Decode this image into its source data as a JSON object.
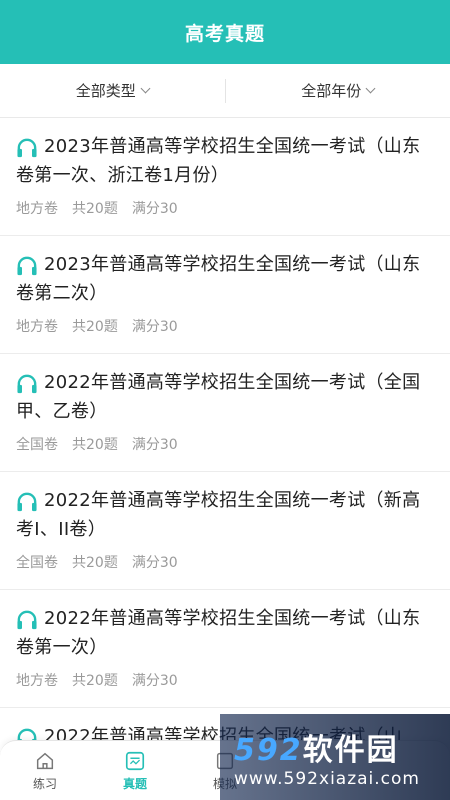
{
  "header": {
    "title": "高考真题"
  },
  "filters": {
    "type_label": "全部类型",
    "year_label": "全部年份"
  },
  "papers": [
    {
      "title": "2023年普通高等学校招生全国统一考试（山东卷第一次、浙江卷1月份）",
      "category": "地方卷",
      "count": "共20题",
      "score": "满分30"
    },
    {
      "title": "2023年普通高等学校招生全国统一考试（山东卷第二次）",
      "category": "地方卷",
      "count": "共20题",
      "score": "满分30"
    },
    {
      "title": "2022年普通高等学校招生全国统一考试（全国甲、乙卷）",
      "category": "全国卷",
      "count": "共20题",
      "score": "满分30"
    },
    {
      "title": "2022年普通高等学校招生全国统一考试（新高考I、II卷）",
      "category": "全国卷",
      "count": "共20题",
      "score": "满分30"
    },
    {
      "title": "2022年普通高等学校招生全国统一考试（山东卷第一次）",
      "category": "地方卷",
      "count": "共20题",
      "score": "满分30"
    },
    {
      "title": "2022年普通高等学校招生全国统一考试（山",
      "category": "",
      "count": "",
      "score": ""
    }
  ],
  "nav": {
    "practice": "练习",
    "exams": "真题",
    "mock": "模拟"
  },
  "watermark": {
    "brand_num": "592",
    "brand_text": "软件园",
    "url": "www.592xiazai.com"
  },
  "colors": {
    "accent": "#25bfb6"
  }
}
